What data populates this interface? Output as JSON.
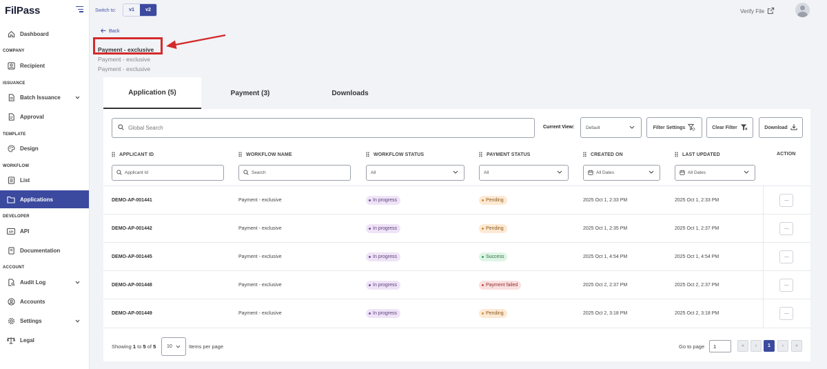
{
  "brand": {
    "logo": "FilPass"
  },
  "sidebar": {
    "sections": {
      "company": "COMPANY",
      "issuance": "ISSUANCE",
      "template": "TEMPLATE",
      "workflow": "WORKFLOW",
      "developer": "DEVELOPER",
      "account": "ACCOUNT"
    },
    "items": {
      "dashboard": "Dashboard",
      "recipient": "Recipient",
      "batch_issuance": "Batch Issuance",
      "approval": "Approval",
      "design": "Design",
      "list": "List",
      "applications": "Applications",
      "api": "API",
      "documentation": "Documentation",
      "audit_log": "Audit Log",
      "accounts": "Accounts",
      "settings": "Settings",
      "legal": "Legal"
    },
    "active_item": "Applications"
  },
  "topbar": {
    "switch_label": "Switch to:",
    "versions": [
      "v1",
      "v2"
    ],
    "selected_version": "v2",
    "verify_file": "Verify File"
  },
  "header": {
    "back": "Back",
    "title": "Payment - exclusive",
    "subtitle_1": "Payment - exclusive",
    "subtitle_2": "Payment - exclusive"
  },
  "tabs": [
    {
      "label": "Application (5)",
      "active": true
    },
    {
      "label": "Payment (3)",
      "active": false
    },
    {
      "label": "Downloads",
      "active": false
    }
  ],
  "toolbar": {
    "search_placeholder": "Global Search",
    "current_view_label": "Current View:",
    "current_view_value": "Default",
    "filter_settings": "Filter Settings",
    "clear_filter": "Clear Filter",
    "download": "Download"
  },
  "table": {
    "headers": {
      "applicant_id": "APPLICANT ID",
      "workflow_name": "WORKFLOW NAME",
      "workflow_status": "WORKFLOW STATUS",
      "payment_status": "PAYMENT STATUS",
      "created_on": "CREATED ON",
      "last_updated": "LAST UPDATED",
      "action": "ACTION"
    },
    "filters": {
      "applicant_id_placeholder": "Applicant Id",
      "workflow_name_placeholder": "Search",
      "workflow_status_value": "All",
      "payment_status_value": "All",
      "created_on_value": "All Dates",
      "last_updated_value": "All Dates"
    },
    "rows": [
      {
        "id": "DEMO-AP-001441",
        "workflow": "Payment - exclusive",
        "wstatus": "In progress",
        "pstatus": "Pending",
        "created": "2025 Oct 1, 2:33 PM",
        "updated": "2025 Oct 1, 2:33 PM",
        "action": "···"
      },
      {
        "id": "DEMO-AP-001442",
        "workflow": "Payment - exclusive",
        "wstatus": "In progress",
        "pstatus": "Pending",
        "created": "2025 Oct 1, 2:35 PM",
        "updated": "2025 Oct 1, 2:37 PM",
        "action": "···"
      },
      {
        "id": "DEMO-AP-001445",
        "workflow": "Payment - exclusive",
        "wstatus": "In progress",
        "pstatus": "Success",
        "created": "2025 Oct 1, 4:54 PM",
        "updated": "2025 Oct 1, 4:54 PM",
        "action": "···"
      },
      {
        "id": "DEMO-AP-001448",
        "workflow": "Payment - exclusive",
        "wstatus": "In progress",
        "pstatus": "Payment failed",
        "created": "2025 Oct 2, 2:37 PM",
        "updated": "2025 Oct 2, 2:37 PM",
        "action": "···"
      },
      {
        "id": "DEMO-AP-001449",
        "workflow": "Payment - exclusive",
        "wstatus": "In progress",
        "pstatus": "Pending",
        "created": "2025 Oct 2, 3:18 PM",
        "updated": "2025 Oct 2, 3:18 PM",
        "action": "···"
      }
    ]
  },
  "pagination": {
    "showing_prefix": "Showing",
    "range_start": "1",
    "to": "to",
    "range_end": "5",
    "of": "of",
    "total": "5",
    "per_page_value": "10",
    "per_page_label": "Items per page",
    "goto_label": "Go to page",
    "goto_value": "1",
    "first": "«",
    "prev": "‹",
    "current_page": "1",
    "next": "›",
    "last": "»"
  },
  "colors": {
    "accent": "#3b4a9e",
    "highlight_red": "#d42a2a",
    "in_progress_bg": "#efe3f7",
    "pending_bg": "#fde9d3",
    "success_bg": "#dff5e6",
    "failed_bg": "#fbe0e0"
  }
}
